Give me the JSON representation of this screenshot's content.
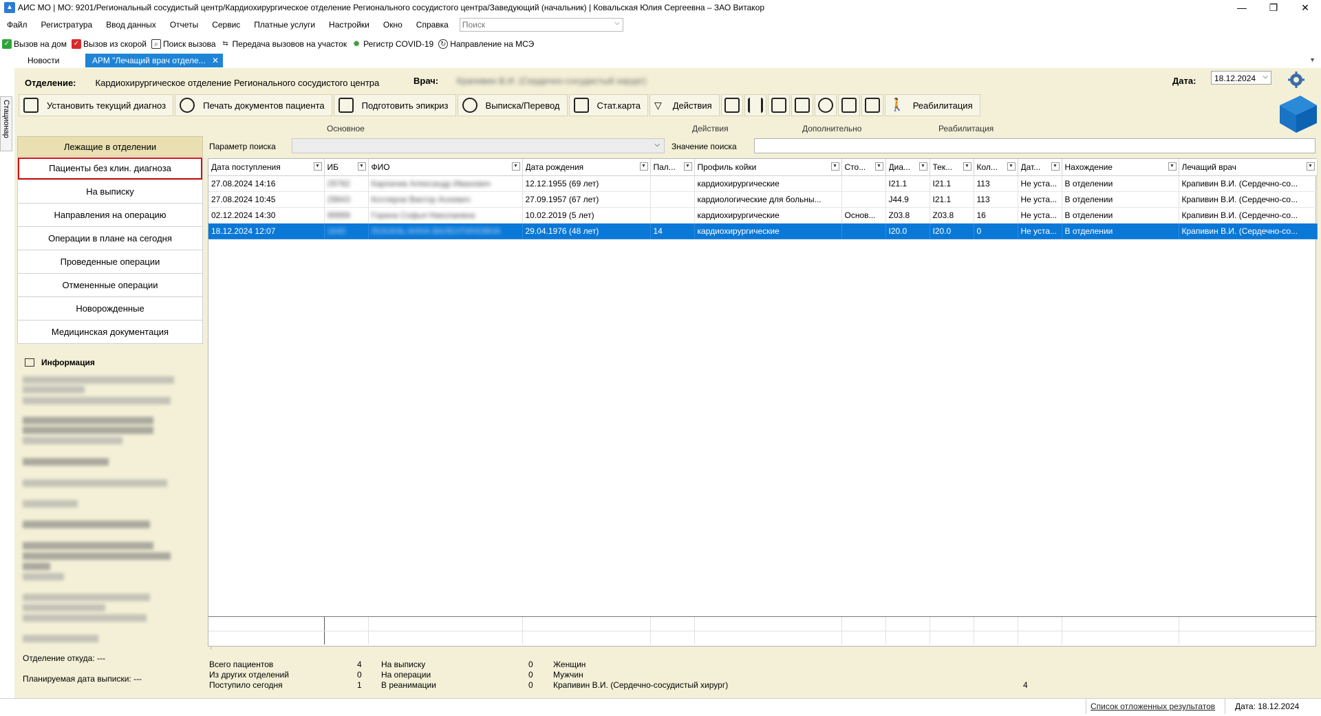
{
  "window": {
    "title": "АИС МО | МО: 9201/Региональный сосудистый центр/Кардиохирургическое отделение Регионального сосудистого центра/Заведующий (начальник) | Ковальская Юлия Сергеевна – ЗАО Витакор",
    "minimize": "—",
    "maximize": "❐",
    "close": "✕"
  },
  "menu": {
    "items": [
      "Файл",
      "Регистратура",
      "Ввод данных",
      "Отчеты",
      "Сервис",
      "Платные услуги",
      "Настройки",
      "Окно",
      "Справка"
    ],
    "search_placeholder": "Поиск"
  },
  "quickbar": [
    {
      "label": "Вызов на дом",
      "icon": "check-home-icon",
      "color": "#2fa33a"
    },
    {
      "label": "Вызов из скорой",
      "icon": "check-ambulance-icon",
      "color": "#d62b2b"
    },
    {
      "label": "Поиск вызова",
      "icon": "search-call-icon",
      "color": "#3a3a3a"
    },
    {
      "label": "Передача вызовов на участок",
      "icon": "transfer-icon",
      "color": "#3a3a3a"
    },
    {
      "label": "Регистр COVID-19",
      "icon": "virus-icon",
      "color": "#3c9a3c"
    },
    {
      "label": "Направление на МСЭ",
      "icon": "direction-icon",
      "color": "#3a3a3a"
    }
  ],
  "tabs": {
    "news": "Новости",
    "arm": "АРМ \"Лечащий врач отделе...",
    "close": "✕"
  },
  "sidetab": "Стационар",
  "header": {
    "dept_label": "Отделение:",
    "dept_value": "Кардиохирургическое отделение Регионального сосудистого центра",
    "doctor_label": "Врач:",
    "doctor_value": "Крапивин В.И. (Сердечно-сосудистый хирург)",
    "date_label": "Дата:",
    "date_value": "18.12.2024"
  },
  "actions": {
    "set_diagnosis": "Установить текущий диагноз",
    "print_docs": "Печать документов пациента",
    "prepare_epicrisis": "Подготовить эпикриз",
    "discharge": "Выписка/Перевод",
    "statcard": "Стат.карта",
    "actions": "Действия",
    "rehab": "Реабилитация"
  },
  "groups": {
    "main": "Основное",
    "actions": "Действия",
    "additional": "Дополнительно",
    "rehab": "Реабилитация"
  },
  "leftnav": {
    "header": "Лежащие в отделении",
    "items": [
      "Пациенты без клин. диагноза",
      "На выписку",
      "Направления на операцию",
      "Операции в плане на сегодня",
      "Проведенные операции",
      "Отмененные операции",
      "Новорожденные",
      "Медицинская документация"
    ],
    "selected": 0
  },
  "info": {
    "title": "Информация",
    "from_label": "Отделение откуда: ---",
    "plan_label": "Планируемая дата выписки: ---"
  },
  "search": {
    "param_label": "Параметр поиска",
    "value_label": "Значение поиска"
  },
  "grid": {
    "columns": [
      "Дата поступления",
      "ИБ",
      "ФИО",
      "Дата рождения",
      "Пал...",
      "Профиль койки",
      "Сто...",
      "Диа...",
      "Тек...",
      "Кол...",
      "Дат...",
      "Нахождение",
      "Лечащий врач"
    ],
    "rows": [
      [
        "27.08.2024 14:16",
        "29782",
        "Карпачев Александр Иванович",
        "12.12.1955 (69 лет)",
        "",
        "кардиохирургические",
        "",
        "I21.1",
        "I21.1",
        "113",
        "Не уста...",
        "В отделении",
        "Крапивин В.И. (Сердечно-со..."
      ],
      [
        "27.08.2024 10:45",
        "29843",
        "Котляров Виктор Асеевич",
        "27.09.1957 (67 лет)",
        "",
        "кардиологические для больны...",
        "",
        "J44.9",
        "I21.1",
        "113",
        "Не уста...",
        "В отделении",
        "Крапивин В.И. (Сердечно-со..."
      ],
      [
        "02.12.2024 14:30",
        "99999",
        "Горина Софья Николаевна",
        "10.02.2019 (5 лет)",
        "",
        "кардиохирургические",
        "Основ...",
        "Z03.8",
        "Z03.8",
        "16",
        "Не уста...",
        "В отделении",
        "Крапивин В.И. (Сердечно-со..."
      ],
      [
        "18.12.2024 12:07",
        "1640",
        "ЛОХАНЬ АННА ВАЛЕНТИНОВНА",
        "29.04.1976 (48 лет)",
        "14",
        "кардиохирургические",
        "",
        "I20.0",
        "I20.0",
        "0",
        "Не уста...",
        "В отделении",
        "Крапивин В.И. (Сердечно-со..."
      ]
    ],
    "selected_row": 3
  },
  "summary": {
    "total_label": "Всего пациентов",
    "total": "4",
    "other_label": "Из других отделений",
    "other": "0",
    "today_label": "Поступило сегодня",
    "today": "1",
    "discharge_label": "На выписку",
    "discharge": "0",
    "surgery_label": "На операции",
    "surgery": "0",
    "icu_label": "В реанимации",
    "icu": "0",
    "women_label": "Женщин",
    "men_label": "Мужчин",
    "doctor_label": "Крапивин В.И. (Сердечно-сосудистый хирург)",
    "doctor_count": "4"
  },
  "status": {
    "deferred": "Список отложенных результатов",
    "date": "Дата: 18.12.2024"
  },
  "colors": {
    "panel": "#f3f0d7",
    "selection": "#0a78d7",
    "accent_red": "#d01010"
  }
}
